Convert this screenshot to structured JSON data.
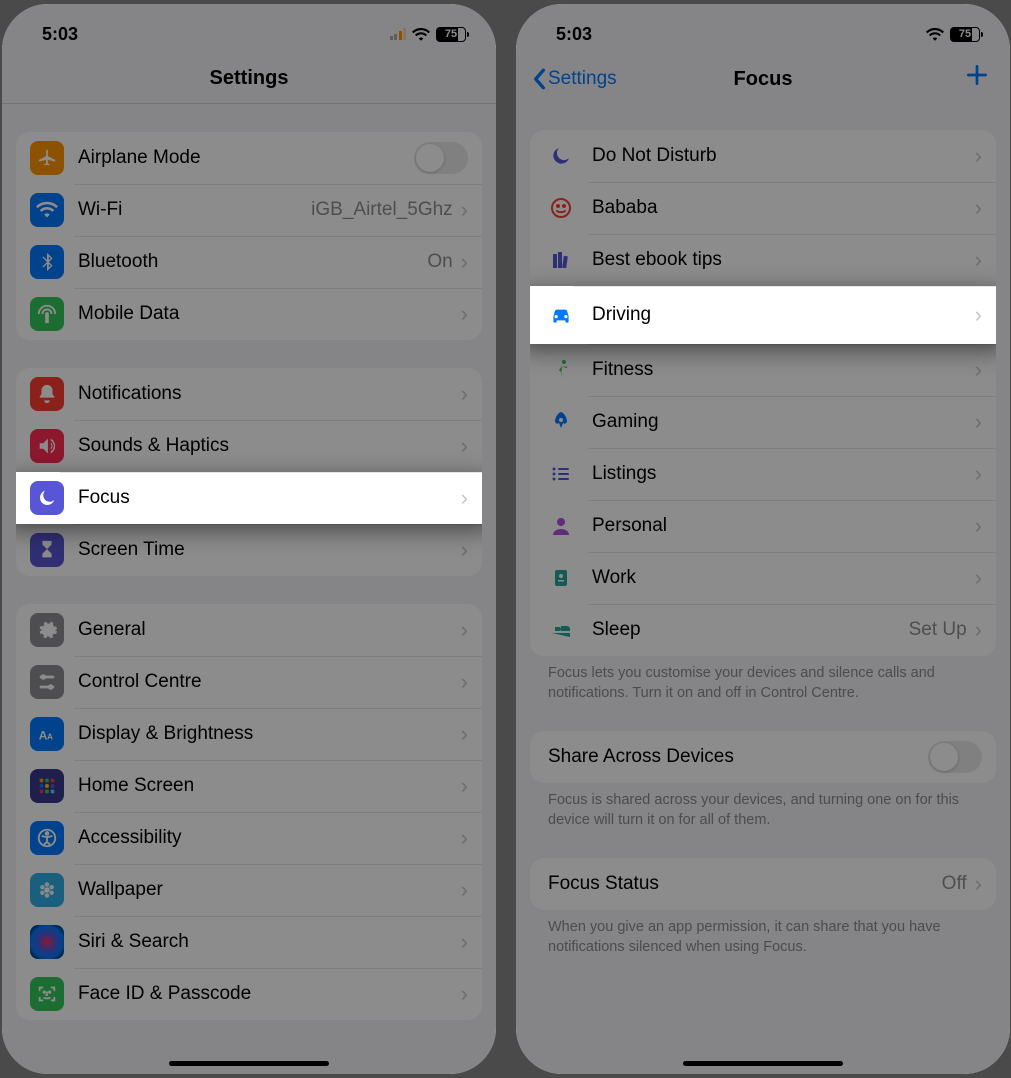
{
  "status": {
    "time": "5:03",
    "battery": "75"
  },
  "left": {
    "title": "Settings",
    "group1": {
      "airplane": "Airplane Mode",
      "wifi": "Wi-Fi",
      "wifi_val": "iGB_Airtel_5Ghz",
      "bluetooth": "Bluetooth",
      "bluetooth_val": "On",
      "mobile": "Mobile Data"
    },
    "group2": {
      "notifications": "Notifications",
      "sounds": "Sounds & Haptics",
      "focus": "Focus",
      "screentime": "Screen Time"
    },
    "group3": {
      "general": "General",
      "control": "Control Centre",
      "display": "Display & Brightness",
      "home": "Home Screen",
      "accessibility": "Accessibility",
      "wallpaper": "Wallpaper",
      "siri": "Siri & Search",
      "faceid": "Face ID & Passcode"
    }
  },
  "right": {
    "back": "Settings",
    "title": "Focus",
    "items": {
      "dnd": "Do Not Disturb",
      "bababa": "Bababa",
      "ebook": "Best ebook tips",
      "driving": "Driving",
      "fitness": "Fitness",
      "gaming": "Gaming",
      "listings": "Listings",
      "personal": "Personal",
      "work": "Work",
      "sleep": "Sleep",
      "sleep_val": "Set Up"
    },
    "footer1": "Focus lets you customise your devices and silence calls and notifications. Turn it on and off in Control Centre.",
    "share": "Share Across Devices",
    "footer2": "Focus is shared across your devices, and turning one on for this device will turn it on for all of them.",
    "status": "Focus Status",
    "status_val": "Off",
    "footer3": "When you give an app permission, it can share that you have notifications silenced when using Focus."
  }
}
